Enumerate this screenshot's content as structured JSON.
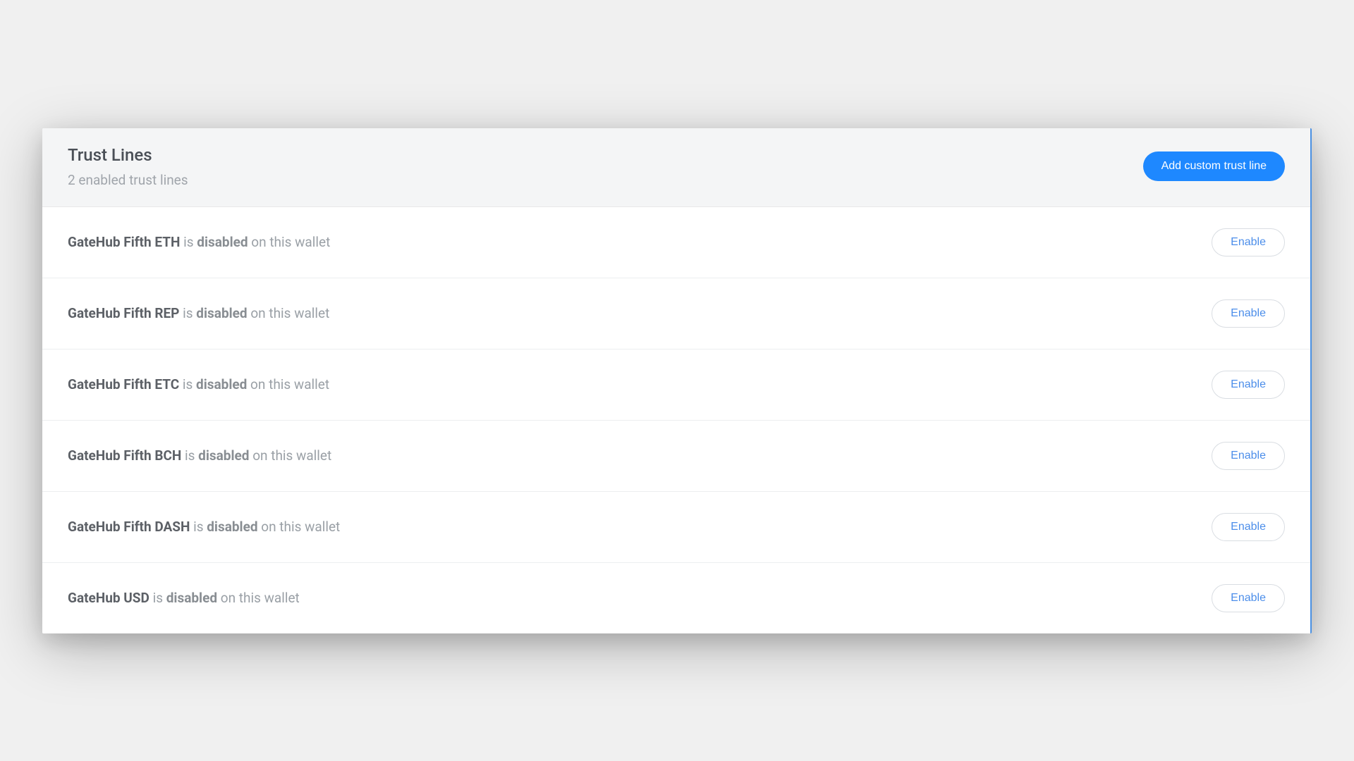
{
  "header": {
    "title": "Trust Lines",
    "subtitle": "2 enabled trust lines",
    "add_button": "Add custom trust line"
  },
  "row_text": {
    "is": " is ",
    "on_wallet": " on this wallet"
  },
  "rows": [
    {
      "name": "GateHub Fifth ETH",
      "state": "disabled",
      "action": "Enable"
    },
    {
      "name": "GateHub Fifth REP",
      "state": "disabled",
      "action": "Enable"
    },
    {
      "name": "GateHub Fifth ETC",
      "state": "disabled",
      "action": "Enable"
    },
    {
      "name": "GateHub Fifth BCH",
      "state": "disabled",
      "action": "Enable"
    },
    {
      "name": "GateHub Fifth DASH",
      "state": "disabled",
      "action": "Enable"
    },
    {
      "name": "GateHub USD",
      "state": "disabled",
      "action": "Enable"
    }
  ]
}
